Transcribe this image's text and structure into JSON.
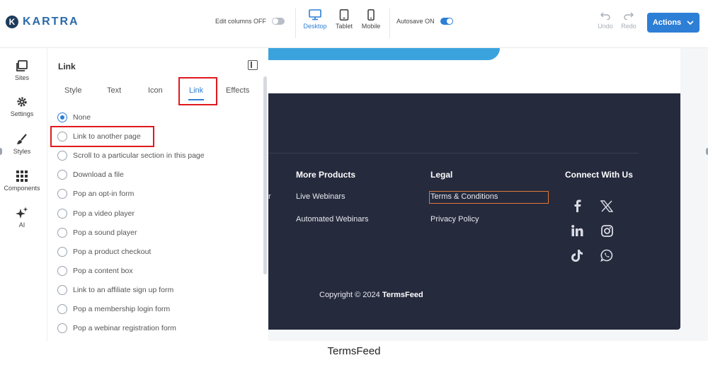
{
  "app": {
    "brand": "KARTRA",
    "brand_mark": "K"
  },
  "toolbar": {
    "edit_columns_label": "Edit columns OFF",
    "autosave_label": "Autosave ON",
    "devices": [
      {
        "label": "Desktop",
        "active": true
      },
      {
        "label": "Tablet",
        "active": false
      },
      {
        "label": "Mobile",
        "active": false
      }
    ],
    "undo_label": "Undo",
    "redo_label": "Redo",
    "actions_label": "Actions"
  },
  "sidebar": {
    "items": [
      {
        "label": "Sites",
        "icon": "sites-icon"
      },
      {
        "label": "Settings",
        "icon": "gear-icon"
      },
      {
        "label": "Styles",
        "icon": "brush-icon"
      },
      {
        "label": "Components",
        "icon": "grid-icon"
      },
      {
        "label": "AI",
        "icon": "sparkle-icon"
      }
    ]
  },
  "panel": {
    "title": "Link",
    "tabs": [
      {
        "label": "Style",
        "active": false
      },
      {
        "label": "Text",
        "active": false
      },
      {
        "label": "Icon",
        "active": false
      },
      {
        "label": "Link",
        "active": true
      },
      {
        "label": "Effects",
        "active": false
      }
    ],
    "options": [
      {
        "label": "None",
        "selected": true
      },
      {
        "label": "Link to another page",
        "selected": false
      },
      {
        "label": "Scroll to a particular section in this page",
        "selected": false
      },
      {
        "label": "Download a file",
        "selected": false
      },
      {
        "label": "Pop an opt-in form",
        "selected": false
      },
      {
        "label": "Pop a video player",
        "selected": false
      },
      {
        "label": "Pop a sound player",
        "selected": false
      },
      {
        "label": "Pop a product checkout",
        "selected": false
      },
      {
        "label": "Pop a content box",
        "selected": false
      },
      {
        "label": "Link to an affiliate sign up form",
        "selected": false
      },
      {
        "label": "Pop a membership login form",
        "selected": false
      },
      {
        "label": "Pop a webinar registration form",
        "selected": false
      }
    ]
  },
  "footer": {
    "partial_text": "r",
    "columns": [
      {
        "heading": "More Products",
        "links": [
          "Live Webinars",
          "Automated Webinars"
        ]
      },
      {
        "heading": "Legal",
        "links": [
          "Terms & Conditions",
          "Privacy Policy"
        ]
      },
      {
        "heading": "Connect With Us",
        "icons": [
          "facebook-icon",
          "x-icon",
          "linkedin-icon",
          "instagram-icon",
          "tiktok-icon",
          "whatsapp-icon"
        ]
      }
    ],
    "copyright_prefix": "Copyright © 2024",
    "copyright_brand": "TermsFeed"
  },
  "caption": "TermsFeed",
  "colors": {
    "accent": "#2d7fd6",
    "footer_bg": "#262a3d",
    "highlight_red": "#e0191d",
    "highlight_orange": "#e07a3a"
  }
}
